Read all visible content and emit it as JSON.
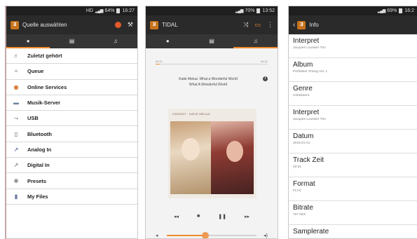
{
  "phone1": {
    "status": {
      "net": "HD",
      "battery": "64%",
      "time": "16:27"
    },
    "appbar": {
      "title": "Quelle auswählen",
      "tool_icon": "⚒"
    },
    "tabs": [
      {
        "name": "home",
        "icon": "●",
        "active": true
      },
      {
        "name": "list",
        "icon": "▤",
        "active": false
      },
      {
        "name": "music",
        "icon": "♫",
        "active": false
      }
    ],
    "menu": [
      {
        "label": "Zuletzt gehört",
        "icon": "recent-icon",
        "glyph": "♬",
        "tone": "grey"
      },
      {
        "label": "Queue",
        "icon": "queue-icon",
        "glyph": "≡",
        "tone": "grey"
      },
      {
        "label": "Online Services",
        "icon": "online-services-icon",
        "glyph": "◉",
        "tone": "orange"
      },
      {
        "label": "Musik-Server",
        "icon": "music-server-icon",
        "glyph": "▬",
        "tone": "blue"
      },
      {
        "label": "USB",
        "icon": "usb-icon",
        "glyph": "⇁",
        "tone": "grey"
      },
      {
        "label": "Bluetooth",
        "icon": "bluetooth-icon",
        "glyph": "▯",
        "tone": "grey"
      },
      {
        "label": "Analog In",
        "icon": "analog-in-icon",
        "glyph": "↗",
        "tone": "blue"
      },
      {
        "label": "Digital In",
        "icon": "digital-in-icon",
        "glyph": "↗",
        "tone": "grey"
      },
      {
        "label": "Presets",
        "icon": "presets-icon",
        "glyph": "✱",
        "tone": "grey"
      },
      {
        "label": "My Files",
        "icon": "my-files-icon",
        "glyph": "▮",
        "tone": "blue"
      }
    ]
  },
  "phone2": {
    "status": {
      "battery": "70%",
      "time": "13:52"
    },
    "appbar": {
      "title": "TIDAL",
      "shuffle_icon": "⤨",
      "cast_icon": "▭",
      "more_icon": "⋮"
    },
    "tabs": [
      {
        "name": "home",
        "icon": "●",
        "active": false
      },
      {
        "name": "list",
        "icon": "▤",
        "active": false
      },
      {
        "name": "music",
        "icon": "♫",
        "active": true
      }
    ],
    "player": {
      "elapsed": "00:11",
      "duration": "04:41",
      "progress": 0.04,
      "track_line1": "Katie Melua: What a Wonderful World",
      "track_line2": "What A Wonderful World",
      "info_glyph": "i",
      "cover_header": "CASSIDY · KATIE MELUA",
      "controls": {
        "previous": "◂◂",
        "stop": "■",
        "pause": "❚❚",
        "next": "▸▸"
      },
      "volume_low": "◂",
      "volume_high": "◂)",
      "volume": 0.42
    }
  },
  "phone3": {
    "status": {
      "battery": "69%",
      "time": "16:2"
    },
    "appbar": {
      "back": "‹",
      "title": "Info"
    },
    "items": [
      {
        "label": "Interpret",
        "value": "Jacques Loussier Trio"
      },
      {
        "label": "Album",
        "value": "Perfektes Timing Vol. 1"
      },
      {
        "label": "Genre",
        "value": "Unbekannt"
      },
      {
        "label": "Interpret",
        "value": "Jacques Loussier Trio"
      },
      {
        "label": "Datum",
        "value": "2015-01-01"
      },
      {
        "label": "Track Zeit",
        "value": "02:51"
      },
      {
        "label": "Format",
        "value": "FLAC"
      },
      {
        "label": "Bitrate",
        "value": "727 kb/s"
      },
      {
        "label": "Samplerate",
        "value": ""
      }
    ]
  },
  "colors": {
    "accent": "#ef8a2a",
    "appbar": "#2a2a2a",
    "tabbar": "#353535",
    "logo": "#c8731c"
  }
}
